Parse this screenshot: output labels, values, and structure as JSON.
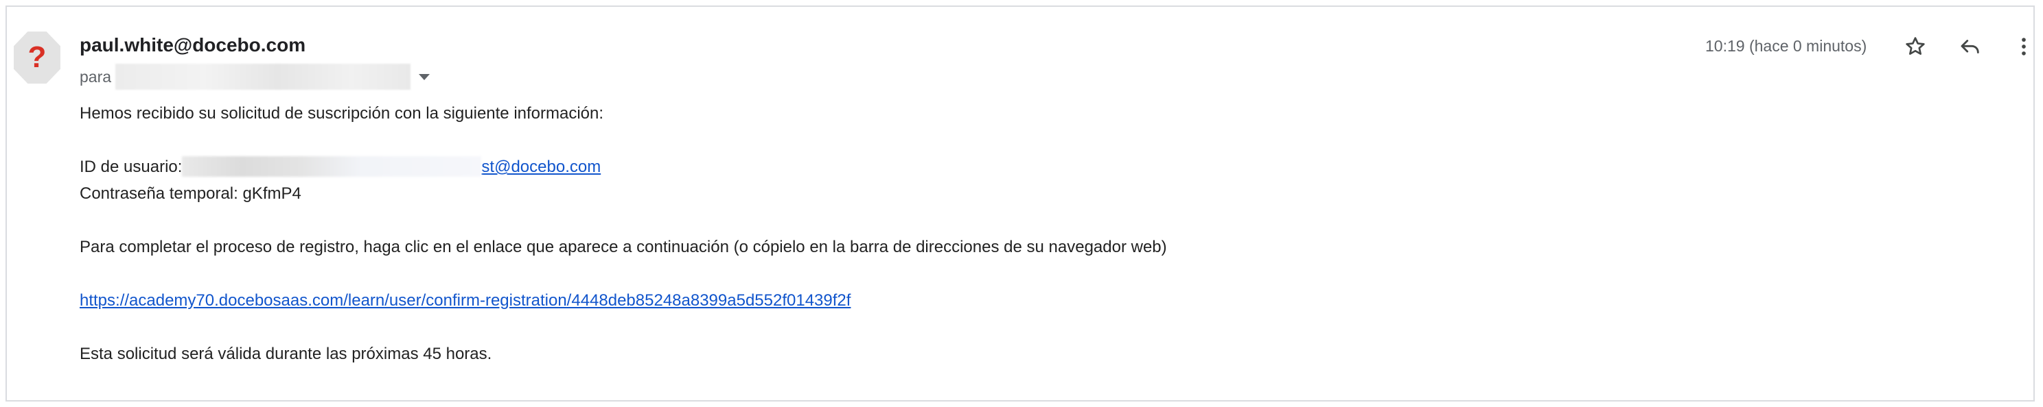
{
  "header": {
    "sender_email": "paul.white@docebo.com",
    "to_label": "para",
    "timestamp": "10:19 (hace 0 minutos)",
    "avatar_glyph": "?"
  },
  "icons": {
    "avatar": "unknown-sender-icon",
    "star": "star-icon",
    "reply": "reply-icon",
    "more": "more-vert-icon",
    "recipients": "chevron-down-icon"
  },
  "body": {
    "intro": "Hemos recibido su solicitud de suscripción con la siguiente información:",
    "user_id_label": "ID de usuario:",
    "user_id_link_visible": "st@docebo.com",
    "temp_password": "Contraseña temporal: gKfmP4",
    "instructions": "Para completar el proceso de registro, haga clic en el enlace que aparece a continuación (o cópielo en la barra de direcciones de su navegador web)",
    "confirm_link": "https://academy70.docebosaas.com/learn/user/confirm-registration/4448deb85248a8399a5d552f01439f2f",
    "validity": "Esta solicitud será válida durante las próximas 45 horas."
  },
  "colors": {
    "link": "#1155cc",
    "avatar_glyph": "#d93025",
    "muted_text": "#5f6368",
    "border": "#dadce0"
  }
}
